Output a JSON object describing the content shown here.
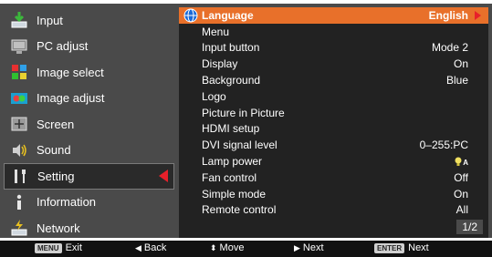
{
  "colors": {
    "background": "#4a4a4a",
    "submenu_background": "#222222",
    "highlight": "#e8702a",
    "selection_arrow": "#e8202a"
  },
  "left_menu": {
    "items": [
      {
        "label": "Input",
        "icon": "input-icon"
      },
      {
        "label": "PC adjust",
        "icon": "pc-adjust-icon"
      },
      {
        "label": "Image select",
        "icon": "image-select-icon"
      },
      {
        "label": "Image adjust",
        "icon": "image-adjust-icon"
      },
      {
        "label": "Screen",
        "icon": "screen-icon"
      },
      {
        "label": "Sound",
        "icon": "sound-icon"
      },
      {
        "label": "Setting",
        "icon": "setting-icon",
        "selected": true
      },
      {
        "label": "Information",
        "icon": "information-icon"
      },
      {
        "label": "Network",
        "icon": "network-icon"
      }
    ]
  },
  "submenu": {
    "rows": [
      {
        "label": "Language",
        "value": "English",
        "selected": true
      },
      {
        "label": "Menu",
        "value": ""
      },
      {
        "label": "Input button",
        "value": "Mode 2"
      },
      {
        "label": "Display",
        "value": "On"
      },
      {
        "label": "Background",
        "value": "Blue"
      },
      {
        "label": "Logo",
        "value": ""
      },
      {
        "label": "Picture in Picture",
        "value": ""
      },
      {
        "label": "HDMI setup",
        "value": ""
      },
      {
        "label": "DVI signal level",
        "value": "0–255:PC"
      },
      {
        "label": "Lamp power",
        "value": "",
        "value_icon": "lamp-auto-icon",
        "value_icon_text": "A"
      },
      {
        "label": "Fan control",
        "value": "Off"
      },
      {
        "label": "Simple mode",
        "value": "On"
      },
      {
        "label": "Remote control",
        "value": "All"
      }
    ],
    "page_indicator": "1/2"
  },
  "bottom_bar": {
    "exit_key": "MENU",
    "exit_label": "Exit",
    "back_label": "Back",
    "move_label": "Move",
    "next_label": "Next",
    "enter_key": "ENTER",
    "enter_label": "Next"
  }
}
